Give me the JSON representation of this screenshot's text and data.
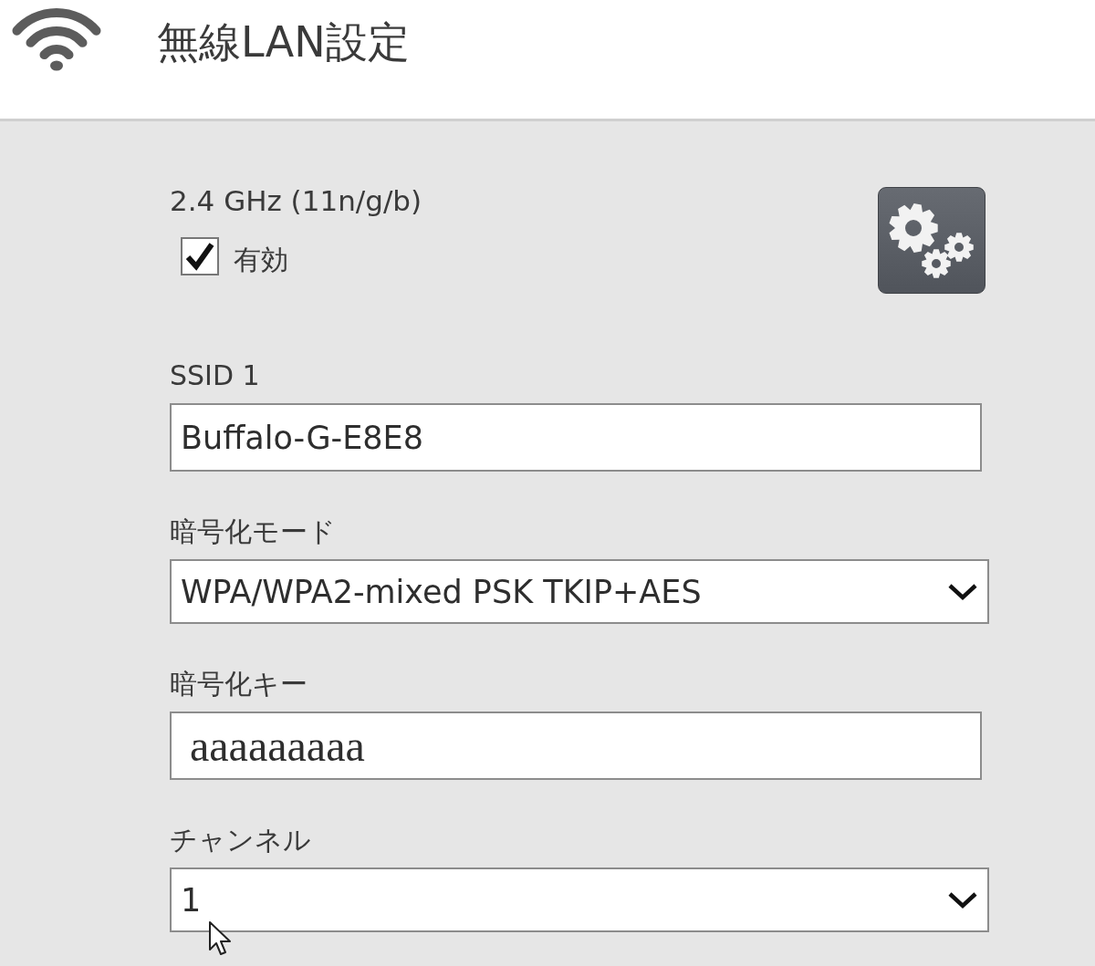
{
  "header": {
    "title": "無線LAN設定"
  },
  "band": {
    "label": "2.4 GHz (11n/g/b)",
    "enabled": {
      "label": "有効",
      "checked": true
    }
  },
  "fields": [
    {
      "kind": "text",
      "label": "SSID 1",
      "value": "Buffalo-G-E8E8"
    },
    {
      "kind": "select",
      "label": "暗号化モード",
      "value": "WPA/WPA2-mixed PSK TKIP+AES"
    },
    {
      "kind": "key",
      "label": "暗号化キー",
      "value": "aaaaaaaaa"
    },
    {
      "kind": "select",
      "label": "チャンネル",
      "value": "1"
    }
  ]
}
